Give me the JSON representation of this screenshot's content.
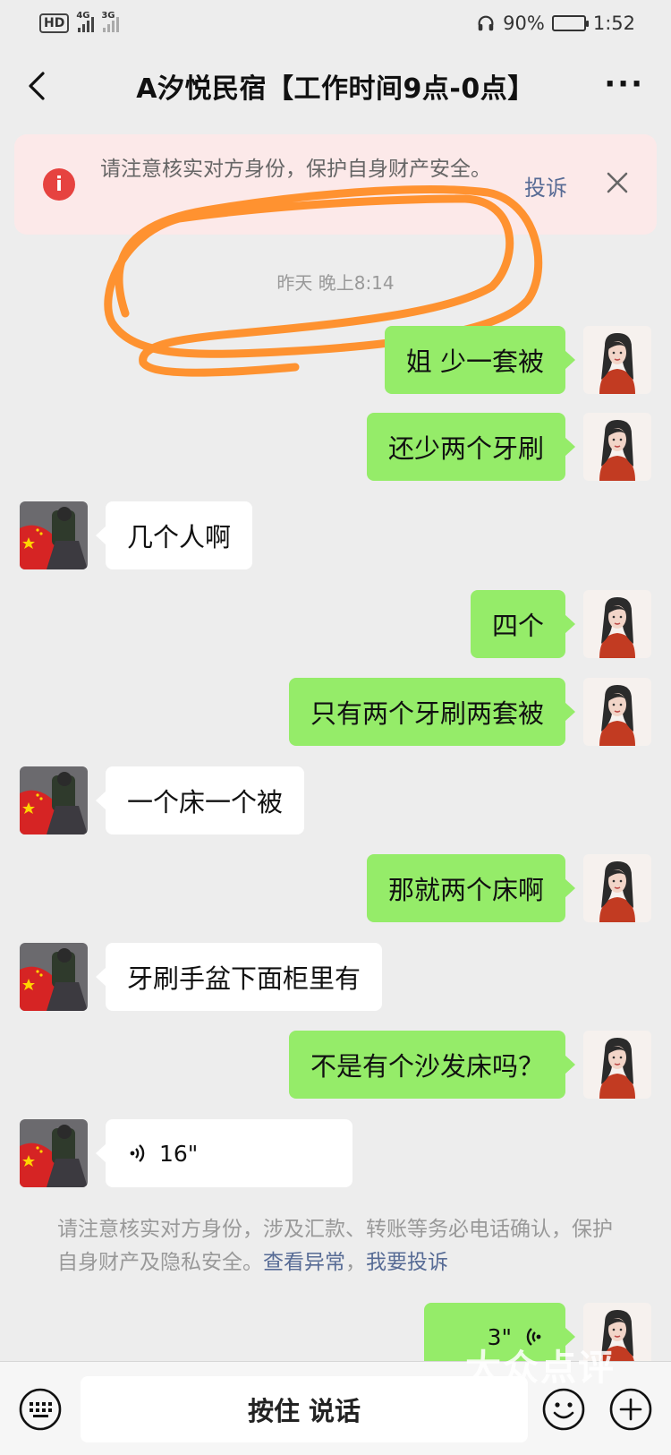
{
  "status_bar": {
    "hd_label": "HD",
    "net1_label": "4G",
    "net2_label": "3G",
    "battery_pct": "90%",
    "battery_level": 0.9,
    "time": "1:52"
  },
  "nav": {
    "title": "A汐悦民宿【工作时间9点-0点】",
    "back_icon": "chevron-left-icon",
    "more_icon": "ellipsis-icon"
  },
  "warning": {
    "text": "请注意核实对方身份，保护自身财产安全。",
    "complain_label": "投诉",
    "accent": "#e64340"
  },
  "timestamp": "昨天 晚上8:14",
  "messages": [
    {
      "from": "me",
      "text": "姐 少一套被"
    },
    {
      "from": "me",
      "text": "还少两个牙刷"
    },
    {
      "from": "other",
      "text": "几个人啊"
    },
    {
      "from": "me",
      "text": "四个"
    },
    {
      "from": "me",
      "text": "只有两个牙刷两套被"
    },
    {
      "from": "other",
      "text": "一个床一个被"
    },
    {
      "from": "me",
      "text": "那就两个床啊"
    },
    {
      "from": "other",
      "text": "牙刷手盆下面柜里有"
    },
    {
      "from": "me",
      "text": "不是有个沙发床吗？"
    },
    {
      "from": "other",
      "type": "voice",
      "duration": "16\""
    }
  ],
  "notice": {
    "text": "请注意核实对方身份，涉及汇款、转账等务必电话确认，保护自身财产及隐私安全。",
    "link1": "查看异常",
    "sep": "，",
    "link2": "我要投诉"
  },
  "last_message": {
    "from": "me",
    "type": "voice",
    "duration": "3\""
  },
  "bottom_bar": {
    "keyboard_icon": "keyboard-icon",
    "talk_label": "按住 说话",
    "emoji_icon": "emoji-icon",
    "plus_icon": "plus-icon"
  },
  "watermark": "大众点评",
  "colors": {
    "my_bubble": "#95ec69",
    "other_bubble": "#ffffff",
    "link": "#576b95",
    "background": "#ededed"
  }
}
